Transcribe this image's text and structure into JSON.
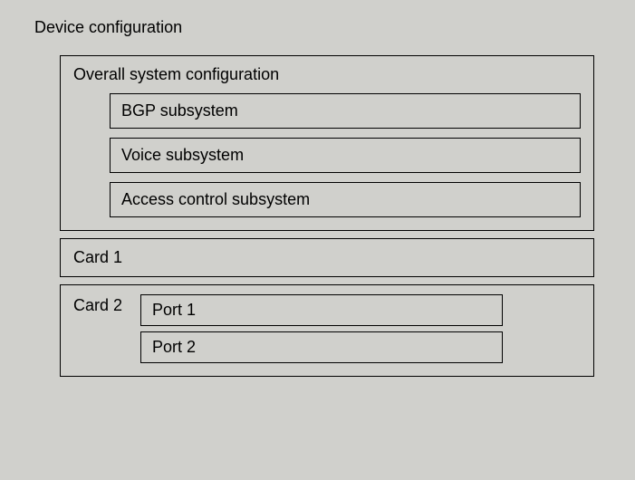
{
  "title": "Device configuration",
  "system": {
    "label": "Overall system configuration",
    "subsystems": [
      "BGP subsystem",
      "Voice subsystem",
      "Access control subsystem"
    ]
  },
  "card1": {
    "label": "Card 1"
  },
  "card2": {
    "label": "Card 2",
    "ports": [
      "Port 1",
      "Port 2"
    ]
  }
}
